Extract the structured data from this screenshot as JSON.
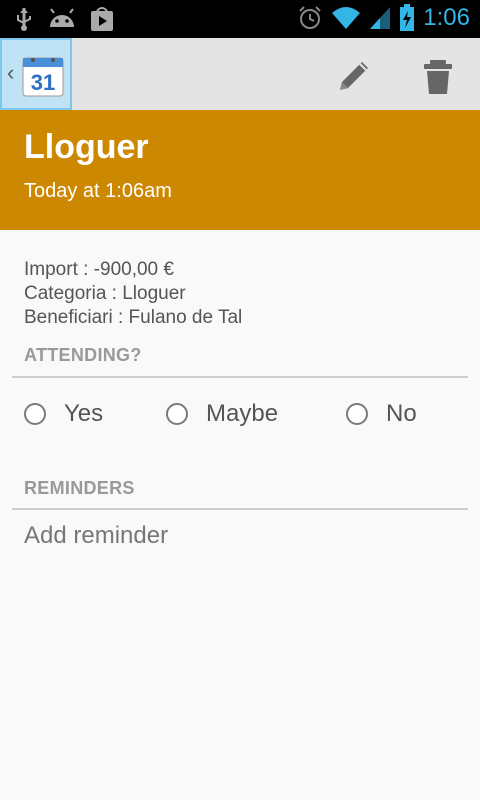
{
  "status_bar": {
    "time": "1:06",
    "icons": [
      "usb-icon",
      "android-debug-icon",
      "play-store-icon",
      "alarm-icon",
      "wifi-icon",
      "signal-icon",
      "battery-charging-icon"
    ]
  },
  "action_bar": {
    "app_icon_number": "31",
    "actions": [
      "edit-icon",
      "delete-icon"
    ]
  },
  "event": {
    "title": "Lloguer",
    "when": "Today at 1:06am",
    "accent_color": "#cc8800",
    "description_lines": [
      "Import : -900,00 €",
      "Categoria : Lloguer",
      "Beneficiari : Fulano de Tal"
    ]
  },
  "attending": {
    "label": "ATTENDING?",
    "options": [
      "Yes",
      "Maybe",
      "No"
    ]
  },
  "reminders": {
    "label": "REMINDERS",
    "add_label": "Add reminder"
  }
}
